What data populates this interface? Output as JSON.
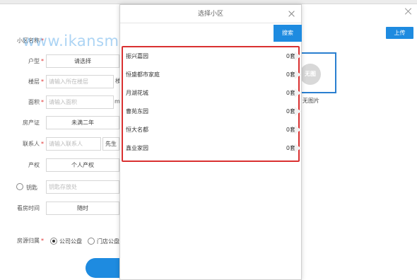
{
  "watermark": "www.ikansms.com",
  "form": {
    "upload_label": "上传",
    "no_image_icon_text": "无图",
    "no_image_label": "无图片",
    "community_label": "小区名称",
    "layout_label": "户型",
    "layout_value": "请选择",
    "floor_label": "楼层",
    "floor_placeholder": "请输入所在楼层",
    "floor_suffix": "楼",
    "area_label": "面积",
    "area_placeholder": "请输入面积",
    "area_unit": "m",
    "cert_label": "房产证",
    "cert_value": "未满二年",
    "contact_label": "联系人",
    "contact_placeholder": "请输入联系人",
    "contact_title": "先生",
    "ownership_label": "产权",
    "ownership_value": "个人产权",
    "key_label": "钥匙",
    "key_placeholder": "钥匙存放处",
    "viewing_label": "看房时间",
    "viewing_value": "随时",
    "source_label": "房源归属",
    "source_option_1": "公司公盘",
    "source_option_2": "门店公盘"
  },
  "modal": {
    "title": "选择小区",
    "search_button": "搜索",
    "items": [
      {
        "name": "振兴嘉园",
        "count": "0套"
      },
      {
        "name": "恒盛都市家庭",
        "count": "0套"
      },
      {
        "name": "月湖花城",
        "count": "0套"
      },
      {
        "name": "曹苑东园",
        "count": "0套"
      },
      {
        "name": "恒大名都",
        "count": "0套"
      },
      {
        "name": "鑫业家园",
        "count": "0套"
      }
    ]
  }
}
